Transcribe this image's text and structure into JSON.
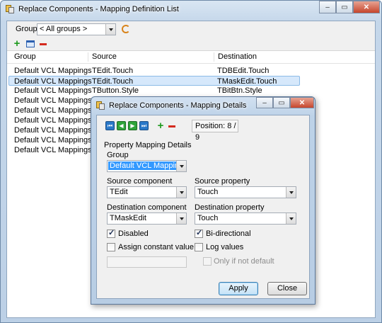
{
  "outer": {
    "title": "Replace Components - Mapping Definition List",
    "group_label": "Group",
    "group_value": "< All groups >",
    "columns": [
      "Group",
      "Source",
      "Destination"
    ],
    "rows": [
      {
        "group": "Default VCL Mappings",
        "source": "TEdit.Touch",
        "destination": "TDBEdit.Touch",
        "selected": false
      },
      {
        "group": "Default VCL Mappings",
        "source": "TEdit.Touch",
        "destination": "TMaskEdit.Touch",
        "selected": true
      },
      {
        "group": "Default VCL Mappings",
        "source": "TButton.Style",
        "destination": "TBitBtn.Style",
        "selected": false
      },
      {
        "group": "Default VCL Mappings",
        "source": "",
        "destination": "",
        "selected": false
      },
      {
        "group": "Default VCL Mappings",
        "source": "",
        "destination": "",
        "selected": false
      },
      {
        "group": "Default VCL Mappings",
        "source": "",
        "destination": "",
        "selected": false
      },
      {
        "group": "Default VCL Mappings",
        "source": "",
        "destination": "",
        "selected": false
      },
      {
        "group": "Default VCL Mappings",
        "source": "",
        "destination": "",
        "selected": false
      },
      {
        "group": "Default VCL Mappings",
        "source": "",
        "destination": "",
        "selected": false
      }
    ]
  },
  "inner": {
    "title": "Replace Components - Mapping Details",
    "position_label": "Position:",
    "position_value": "8 / 9",
    "section_label": "Property Mapping Details",
    "group_label": "Group",
    "group_value": "Default VCL Mappings",
    "source_component_label": "Source component",
    "source_component_value": "TEdit",
    "source_property_label": "Source property",
    "source_property_value": "Touch",
    "dest_component_label": "Destination component",
    "dest_component_value": "TMaskEdit",
    "dest_property_label": "Destination property",
    "dest_property_value": "Touch",
    "disabled_label": "Disabled",
    "bidirectional_label": "Bi-directional",
    "assign_constant_label": "Assign constant value",
    "log_values_label": "Log values",
    "only_if_not_default_label": "Only if not default",
    "apply_label": "Apply",
    "close_label": "Close"
  },
  "icons": {
    "window_icon": "components-window-icon",
    "add": "plus-icon",
    "edit": "edit-window-icon",
    "delete": "minus-icon",
    "refresh": "refresh-icon",
    "nav": [
      "first-record-icon",
      "prior-record-icon",
      "next-record-icon",
      "last-record-icon"
    ]
  },
  "colors": {
    "selection": "#d6e8fb",
    "add_green": "#1e9a1e",
    "delete_red": "#d42a1e",
    "nav_blue": "#2a78c8"
  }
}
